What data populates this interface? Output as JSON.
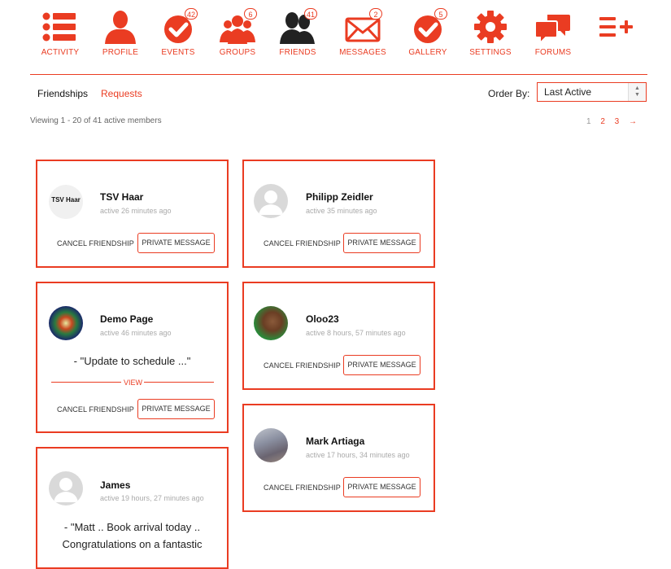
{
  "nav": {
    "activity": {
      "label": "ACTIVITY"
    },
    "profile": {
      "label": "PROFILE"
    },
    "events": {
      "label": "EVENTS",
      "badge": "42"
    },
    "groups": {
      "label": "GROUPS",
      "badge": "6"
    },
    "friends": {
      "label": "FRIENDS",
      "badge": "41"
    },
    "messages": {
      "label": "MESSAGES",
      "badge": "2"
    },
    "gallery": {
      "label": "GALLERY",
      "badge": "5"
    },
    "settings": {
      "label": "SETTINGS"
    },
    "forums": {
      "label": "FORUMS"
    },
    "accent_color": "#ea3c22"
  },
  "subnav": {
    "friendships": "Friendships",
    "requests": "Requests"
  },
  "order": {
    "label": "Order By:",
    "selected": "Last Active"
  },
  "viewing_text": "Viewing 1 - 20 of 41 active members",
  "pagination": {
    "pages": [
      "1",
      "2",
      "3"
    ],
    "next": "→"
  },
  "members": [
    {
      "name": "TSV Haar",
      "avatar_text": "TSV Haar",
      "active": "active 26 minutes ago",
      "cancel": "CANCEL FRIENDSHIP",
      "pm": "PRIVATE MESSAGE"
    },
    {
      "name": "Philipp Zeidler",
      "active": "active 35 minutes ago",
      "cancel": "CANCEL FRIENDSHIP",
      "pm": "PRIVATE MESSAGE"
    },
    {
      "name": "Demo Page",
      "active": "active 46 minutes ago",
      "quote": "- \"Update to schedule ...\"",
      "view": "VIEW",
      "cancel": "CANCEL FRIENDSHIP",
      "pm": "PRIVATE MESSAGE"
    },
    {
      "name": "Oloo23",
      "active": "active 8 hours, 57 minutes ago",
      "cancel": "CANCEL FRIENDSHIP",
      "pm": "PRIVATE MESSAGE"
    },
    {
      "name": "Mark Artiaga",
      "active": "active 17 hours, 34 minutes ago",
      "cancel": "CANCEL FRIENDSHIP",
      "pm": "PRIVATE MESSAGE"
    },
    {
      "name": "James",
      "active": "active 19 hours, 27 minutes ago",
      "quote_line1": "- \"Matt .. Book arrival today ..",
      "quote_line2": "Congratulations on a fantastic"
    }
  ]
}
